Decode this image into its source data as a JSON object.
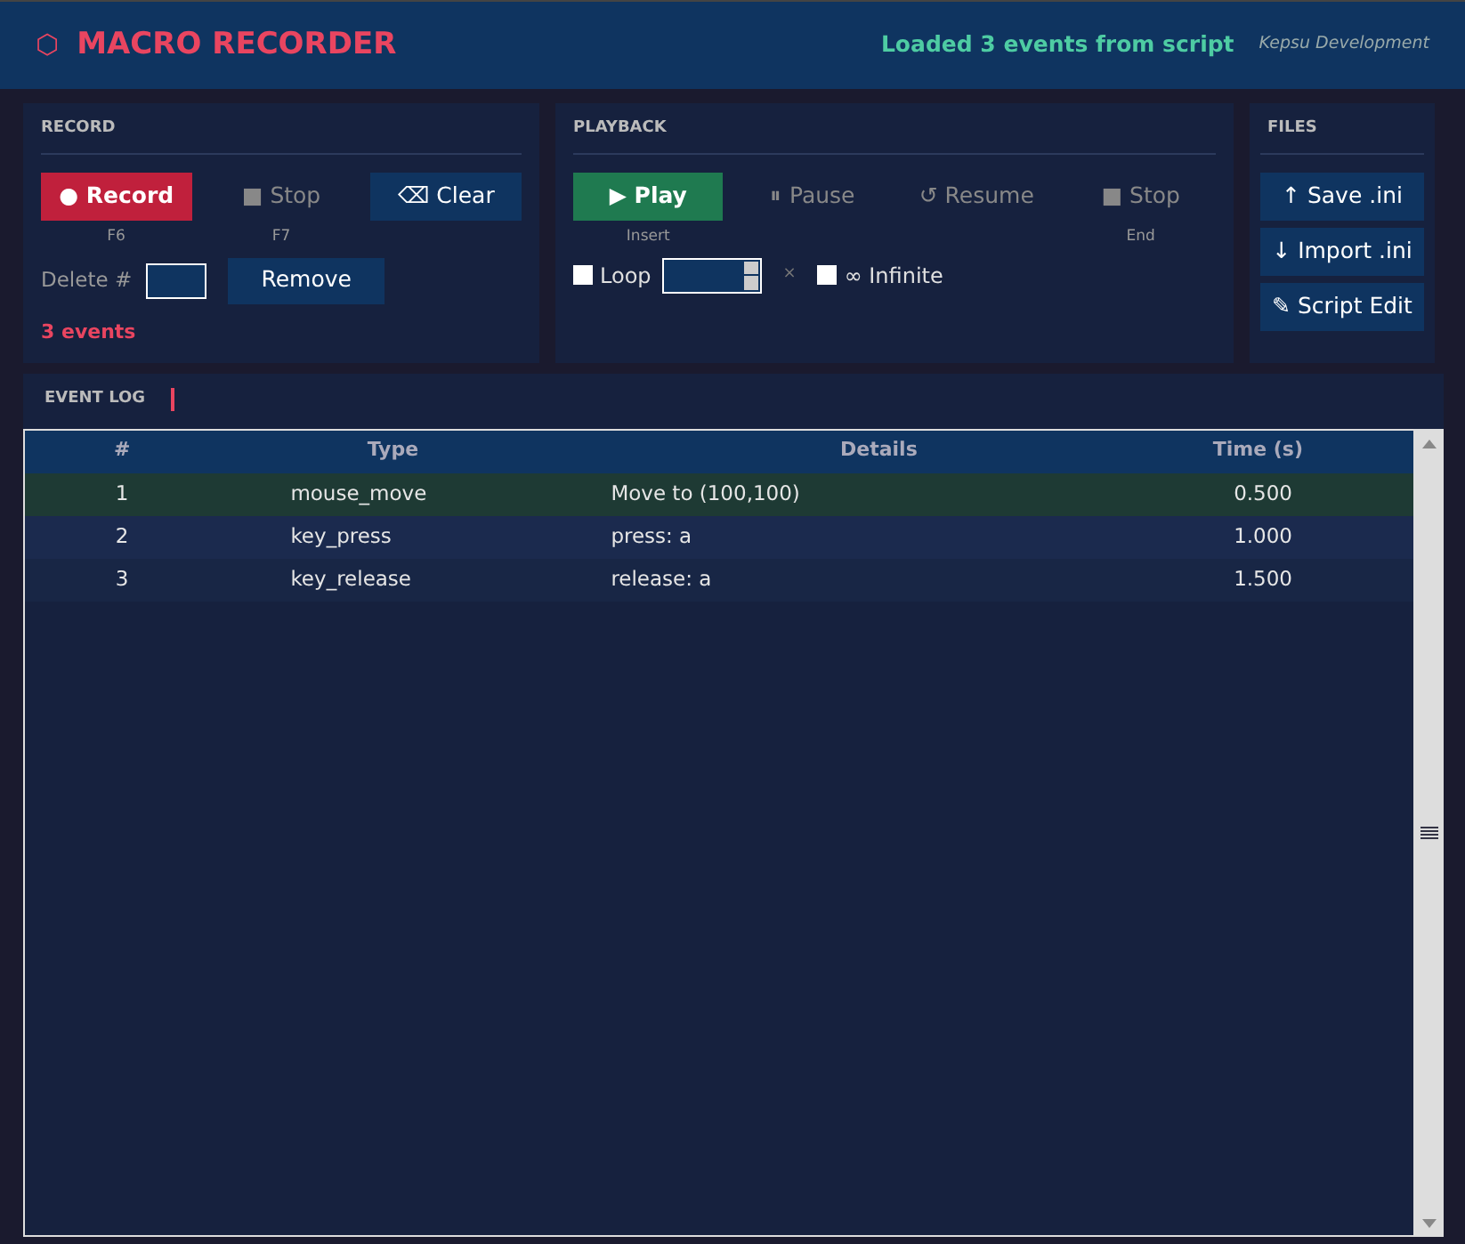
{
  "header": {
    "logo_glyph": "⬡",
    "title": "MACRO RECORDER",
    "status": "Loaded 3 events from script",
    "credit": "Kepsu Development"
  },
  "record": {
    "title": "RECORD",
    "buttons": [
      {
        "label": "● Record",
        "kind": "danger",
        "disabled": false,
        "shortcut": "F6"
      },
      {
        "label": "■ Stop",
        "kind": "flat",
        "disabled": true,
        "shortcut": "F7"
      },
      {
        "label": "⌫ Clear",
        "kind": "blue",
        "disabled": false
      }
    ],
    "delete_label": "Delete #",
    "remove_button": "Remove",
    "count": "3 events"
  },
  "playback": {
    "title": "PLAYBACK",
    "buttons": [
      {
        "label": "▶ Play",
        "kind": "success",
        "disabled": false,
        "shortcut": "Insert"
      },
      {
        "label": "⏸ Pause",
        "kind": "flat",
        "disabled": true
      },
      {
        "label": "↺ Resume",
        "kind": "flat",
        "disabled": true
      },
      {
        "label": "■ Stop",
        "kind": "flat",
        "disabled": true,
        "shortcut": "End"
      }
    ],
    "loop": {
      "label": "Loop",
      "checked": false
    },
    "times": "×",
    "infinite": {
      "label": "∞ Infinite",
      "checked": false
    }
  },
  "files": {
    "title": "FILES",
    "buttons": [
      "↑ Save .ini",
      "↓ Import .ini",
      "✎ Script Edit"
    ]
  },
  "event_log": {
    "title": "EVENT LOG",
    "columns": [
      "#",
      "Type",
      "Details",
      "Time (s)"
    ],
    "rows": [
      {
        "cells": [
          "1",
          "mouse_move",
          "Move to (100,100)",
          "0.500"
        ],
        "selected": true
      },
      {
        "cells": [
          "2",
          "key_press",
          "press: a",
          "1.000"
        ],
        "selected": false
      },
      {
        "cells": [
          "3",
          "key_release",
          "release: a",
          "1.500"
        ],
        "selected": false
      }
    ]
  }
}
